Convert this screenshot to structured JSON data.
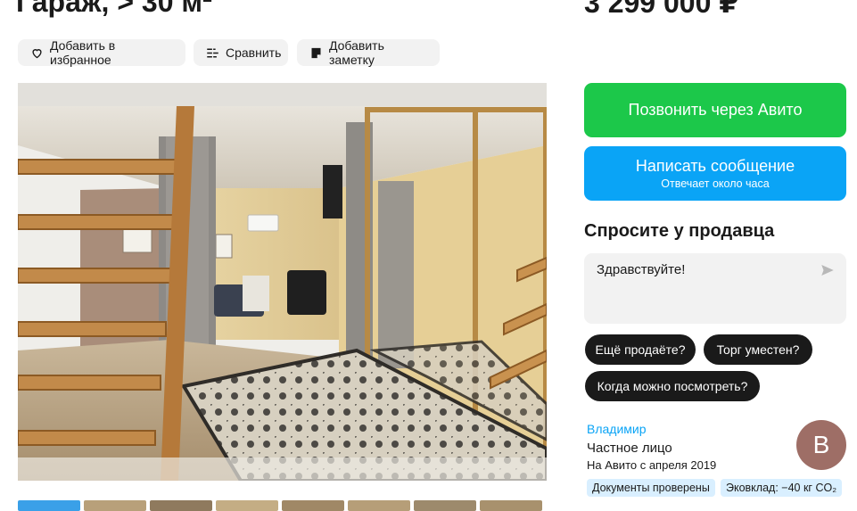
{
  "listing": {
    "title": "Гараж, > 30 м²",
    "price": "3 299 000 ₽"
  },
  "actions": {
    "favorite_label": "Добавить в избранное",
    "compare_label": "Сравнить",
    "note_label": "Добавить заметку"
  },
  "gallery": {
    "main_photo_alt": "",
    "thumb_count": 8
  },
  "contact": {
    "call_label": "Позвонить через Авито",
    "message_label": "Написать сообщение",
    "message_sublabel": "Отвечает около часа"
  },
  "ask": {
    "title": "Спросите у продавца",
    "message_value": "Здравствуйте!",
    "quick_questions": [
      "Ещё продаёте?",
      "Торг уместен?",
      "Когда можно посмотреть?"
    ]
  },
  "seller": {
    "name": "Владимир",
    "type": "Частное лицо",
    "since": "На Авито с апреля 2019",
    "avatar_letter": "В",
    "badges": [
      "Документы проверены",
      "Эковклад: −40 кг CO₂"
    ]
  },
  "colors": {
    "call_green": "#1cc84a",
    "message_blue": "#0aa4f6",
    "link_blue": "#0aa4f6",
    "chip_bg": "#f2f2f2",
    "pill_dark": "#1a1a1a",
    "avatar_bg": "#9e6e66",
    "badge_bg": "#d9efff"
  },
  "icons": {
    "favorite": "heart-outline-icon",
    "compare": "compare-icon",
    "note": "note-icon",
    "send": "send-arrow-icon"
  }
}
